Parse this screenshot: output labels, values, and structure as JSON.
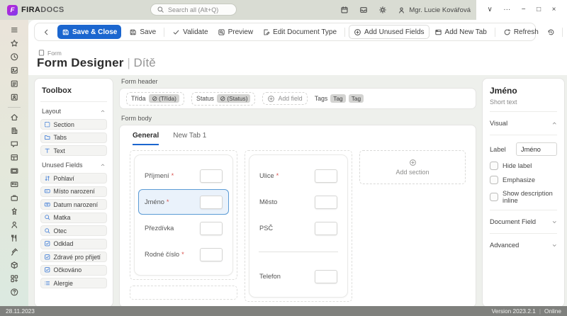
{
  "topbar": {
    "brand_bold": "FIRA",
    "brand_light": "DOCS",
    "brand_initial": "F",
    "search_placeholder": "Search all (Alt+Q)",
    "icons": [
      "calendar",
      "inbox",
      "gear"
    ],
    "user_name": "Mgr. Lucie Kovářová",
    "window_controls": [
      {
        "name": "collapse",
        "glyph": "∨"
      },
      {
        "name": "more",
        "glyph": "···"
      },
      {
        "name": "minimize",
        "glyph": "−"
      },
      {
        "name": "maximize",
        "glyph": "□"
      },
      {
        "name": "close",
        "glyph": "×"
      }
    ]
  },
  "sidebar": {
    "icons": [
      "menu",
      "star",
      "clock",
      "doc-image",
      "doc-lines",
      "doc-user",
      "divider",
      "home",
      "building",
      "chat",
      "table",
      "image-frame",
      "id-card",
      "briefcase",
      "award",
      "person",
      "food",
      "vaccine",
      "cube",
      "apps-plus",
      "help"
    ]
  },
  "toolbar": {
    "save_close": "Save & Close",
    "save": "Save",
    "validate": "Validate",
    "preview": "Preview",
    "edit_document_type": "Edit Document Type",
    "add_unused_fields": "Add Unused Fields",
    "add_new_tab": "Add New Tab",
    "refresh": "Refresh"
  },
  "breadcrumb": {
    "label": "Form"
  },
  "page": {
    "title": "Form Designer",
    "separator": "|",
    "subtitle": "Dítě"
  },
  "toolbox": {
    "title": "Toolbox",
    "sections": [
      {
        "label": "Layout",
        "items": [
          {
            "icon": "section-sq",
            "label": "Section"
          },
          {
            "icon": "tabs-folder",
            "label": "Tabs"
          },
          {
            "icon": "text-T",
            "label": "Text"
          }
        ]
      },
      {
        "label": "Unused Fields",
        "items": [
          {
            "icon": "toggle-vert",
            "label": "Pohlaví"
          },
          {
            "icon": "textbox",
            "label": "Místo narození"
          },
          {
            "icon": "datebox",
            "label": "Datum narození"
          },
          {
            "icon": "lookup",
            "label": "Matka"
          },
          {
            "icon": "lookup",
            "label": "Otec"
          },
          {
            "icon": "checkbox-check",
            "label": "Odklad"
          },
          {
            "icon": "checkbox-check",
            "label": "Zdravé pro přijetí"
          },
          {
            "icon": "checkbox-check",
            "label": "Očkováno"
          },
          {
            "icon": "list",
            "label": "Alergie"
          }
        ]
      }
    ]
  },
  "form_header": {
    "label": "Form header",
    "fields": [
      {
        "label": "Třída",
        "value": "(Třída)"
      },
      {
        "label": "Status",
        "value": "(Status)"
      }
    ],
    "add_field_label": "Add field",
    "tags_label": "Tags",
    "tags": [
      "Tag",
      "Tag"
    ]
  },
  "form_body": {
    "label": "Form body",
    "tabs": [
      {
        "label": "General",
        "active": true
      },
      {
        "label": "New Tab 1",
        "active": false
      }
    ],
    "columns": [
      {
        "zones": [
          {
            "fields": [
              {
                "label": "Příjmení",
                "required": true
              },
              {
                "label": "Jméno",
                "required": true,
                "selected": true
              },
              {
                "label": "Přezdívka"
              },
              {
                "label": "Rodné číslo",
                "required": true
              }
            ]
          },
          {
            "empty": true
          }
        ]
      },
      {
        "zones": [
          {
            "fields": [
              {
                "label": "Ulice",
                "required": true
              },
              {
                "label": "Město"
              },
              {
                "label": "PSČ"
              },
              {
                "divider": true
              },
              {
                "label": "Telefon"
              }
            ]
          }
        ]
      },
      {
        "add_section_label": "Add section"
      }
    ]
  },
  "properties": {
    "title": "Jméno",
    "subtitle": "Short text",
    "visual_label": "Visual",
    "label_row": {
      "label": "Label",
      "value": "Jméno"
    },
    "options": [
      {
        "label": "Hide label",
        "checked": false
      },
      {
        "label": "Emphasize",
        "checked": false
      },
      {
        "label": "Show description inline",
        "checked": false
      }
    ],
    "document_field_label": "Document Field",
    "advanced_label": "Advanced"
  },
  "statusbar": {
    "date": "28.11.2023",
    "version": "Version 2023.2.1",
    "divider": "|",
    "status": "Online"
  },
  "colors": {
    "accent": "#1b66cf",
    "selection_border": "#5b9bd5",
    "selection_bg": "#eaf2fb",
    "required": "#d9534f",
    "statusbar_bg": "#7f807d",
    "brand_gradient_start": "#c026d3",
    "brand_gradient_end": "#7c3aed"
  }
}
